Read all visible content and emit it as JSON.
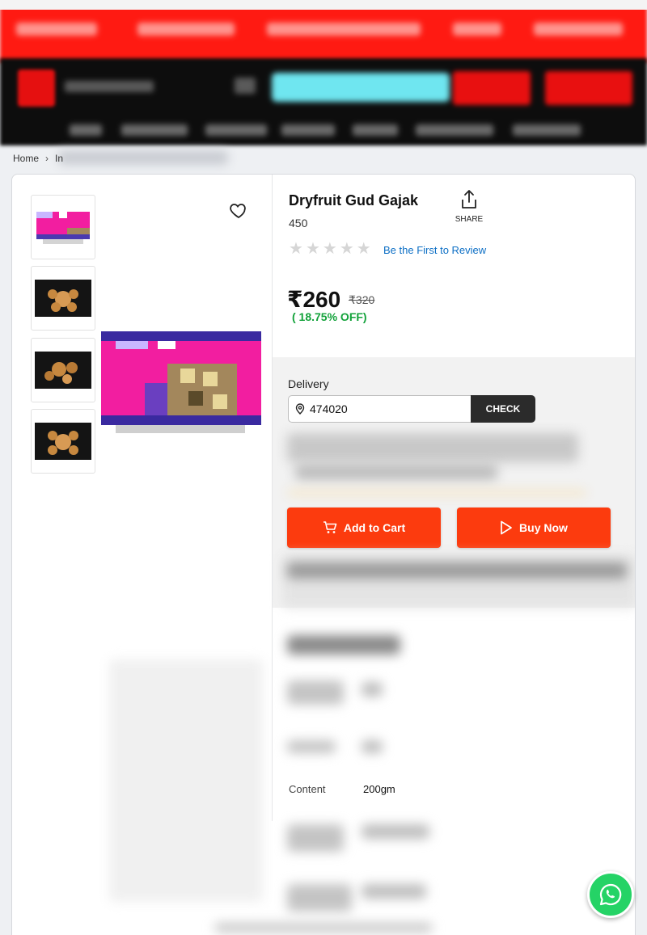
{
  "breadcrumb": {
    "home": "Home",
    "partial": "In"
  },
  "product": {
    "title": "Dryfruit Gud Gajak",
    "weight_label": "450",
    "share_label": "SHARE",
    "review_link": "Be the First to Review",
    "rating_stars": 0,
    "price": "₹260",
    "mrp": "₹320",
    "discount": "( 18.75% OFF)"
  },
  "delivery": {
    "label": "Delivery",
    "pincode": "474020",
    "check_label": "CHECK"
  },
  "actions": {
    "add_to_cart": "Add to Cart",
    "buy_now": "Buy Now"
  },
  "specs": {
    "content_label": "Content",
    "content_value": "200gm"
  },
  "icons": {
    "heart": "heart-icon",
    "share": "share-icon",
    "location": "location-pin-icon",
    "cart": "cart-icon",
    "play": "play-icon",
    "whatsapp": "whatsapp-icon"
  },
  "colors": {
    "header_red": "#ff1a12",
    "header_black": "#0d0d0d",
    "cta_orange": "#fc3b0e",
    "discount_green": "#12a23a",
    "link_blue": "#0d6fc5",
    "whatsapp_green": "#25d366"
  }
}
